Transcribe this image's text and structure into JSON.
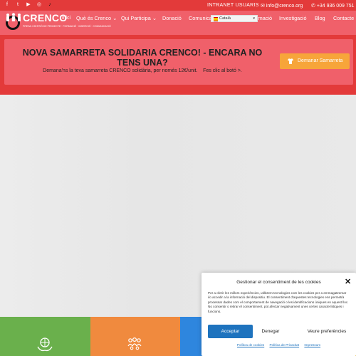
{
  "topbar": {
    "social": [
      {
        "name": "facebook-icon",
        "glyph": "f"
      },
      {
        "name": "twitter-icon",
        "glyph": "t"
      },
      {
        "name": "youtube-icon",
        "glyph": "▶"
      },
      {
        "name": "instagram-icon",
        "glyph": "◎"
      },
      {
        "name": "tiktok-icon",
        "glyph": "♪"
      }
    ],
    "intranet": "INTRANET USUARIS",
    "email": "info@crenco.org",
    "phone": "+34 936 009 751"
  },
  "logo": {
    "brand": "CRENCO",
    "brand_small": "inici",
    "tagline": "PRESA I GESTIÓ DE PROJECTE · FORMACIÓ · INSERCIÓ · COMUNICACIÓ"
  },
  "nav": [
    {
      "label": "Què és Crenco",
      "dropdown": true
    },
    {
      "label": "Qui Participa",
      "dropdown": true
    },
    {
      "label": "Donació",
      "dropdown": false
    },
    {
      "label": "Comunicació",
      "dropdown": false
    },
    {
      "label": "Docència i formació",
      "dropdown": false
    },
    {
      "label": "Investigació",
      "dropdown": false
    },
    {
      "label": "Blog",
      "dropdown": false
    },
    {
      "label": "Contacte",
      "dropdown": false
    }
  ],
  "language": {
    "selected": "Català"
  },
  "banner": {
    "title": "NOVA SAMARRETA SOLIDARIA CRENCO! - ENCARA NO TENS UNA?",
    "subtitle": "Demana'ns la teva samarreta CRENCO solidària, per només 12€/unit.    Fes clic al botó >.",
    "button": "Demanar Samarreta"
  },
  "tiles": [
    {
      "name": "tile-environment",
      "color": "#6ab04c",
      "icon": "hands-globe-icon"
    },
    {
      "name": "tile-community",
      "color": "#f08a3e",
      "icon": "people-group-icon"
    },
    {
      "name": "tile-blue",
      "color": "#2e86de",
      "icon": "blue-icon"
    },
    {
      "name": "tile-yellow",
      "color": "#f5c23a",
      "icon": "yellow-icon"
    }
  ],
  "cookie": {
    "title": "Gestionar el consentiment de les cookies",
    "body": "Per a oferir les millors experiències, utilitzem tecnologies com les cookies per a emmagatzemar i/o accedir a la informació del dispositiu. El consentiment d'aquestes tecnologies ens permetrà processar dades com el comportament de navegació o les identificacions úniques en aquest lloc. No consentir o retirar el consentiment, pot afectar negativament unes certes característiques i funcions.",
    "accept": "Acceptar",
    "deny": "Denegar",
    "preferences": "Veure preferències",
    "links": [
      "Política de cookies",
      "Política de Privacitat",
      "Impressum"
    ]
  },
  "colors": {
    "topbar": "#e33a3a",
    "navbar": "#f0606a",
    "button_orange": "#f7a53a",
    "accept_blue": "#1e73be"
  }
}
